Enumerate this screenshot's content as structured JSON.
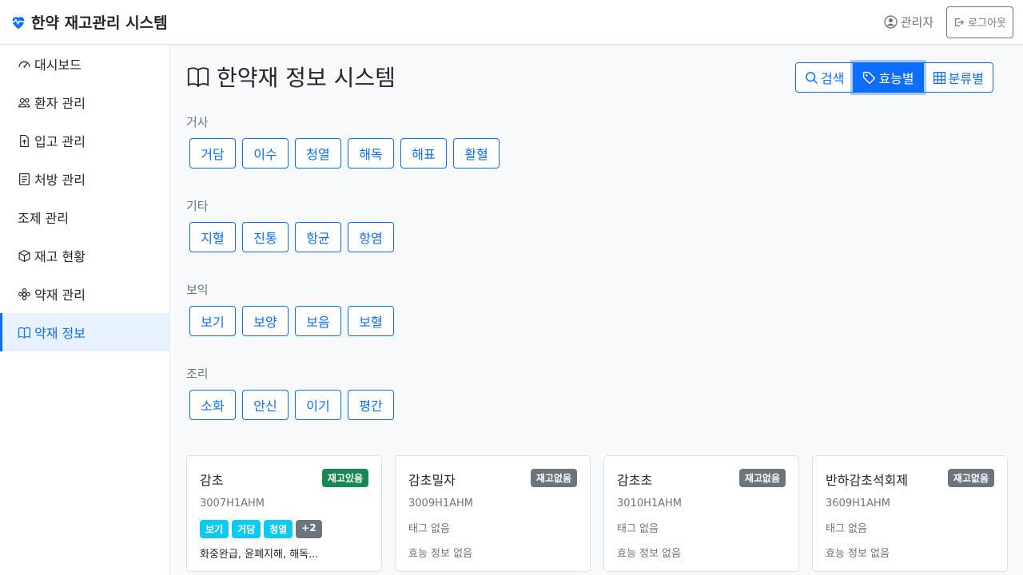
{
  "app": {
    "title": "한약 재고관리 시스템"
  },
  "header": {
    "user": "관리자",
    "logout": "로그아웃"
  },
  "sidebar": {
    "items": [
      {
        "label": "대시보드",
        "icon": "speedometer-icon"
      },
      {
        "label": "환자 관리",
        "icon": "people-icon"
      },
      {
        "label": "입고 관리",
        "icon": "file-arrow-up-icon"
      },
      {
        "label": "처방 관리",
        "icon": "prescription-icon"
      },
      {
        "label": "조제 관리",
        "icon": ""
      },
      {
        "label": "재고 현황",
        "icon": "box-icon"
      },
      {
        "label": "약재 관리",
        "icon": "flower-icon"
      },
      {
        "label": "약재 정보",
        "icon": "book-icon",
        "active": true
      }
    ]
  },
  "main": {
    "title": "한약재 정보 시스템",
    "view_buttons": [
      {
        "label": "검색",
        "icon": "search-icon"
      },
      {
        "label": "효능별",
        "icon": "tag-icon",
        "active": true
      },
      {
        "label": "분류별",
        "icon": "grid-icon"
      }
    ],
    "categories": [
      {
        "label": "거사",
        "tags": [
          "거담",
          "이수",
          "청열",
          "해독",
          "해표",
          "활혈"
        ]
      },
      {
        "label": "기타",
        "tags": [
          "지혈",
          "진통",
          "항균",
          "항염"
        ]
      },
      {
        "label": "보익",
        "tags": [
          "보기",
          "보양",
          "보음",
          "보혈"
        ]
      },
      {
        "label": "조리",
        "tags": [
          "소화",
          "안신",
          "이기",
          "평간"
        ]
      }
    ],
    "cards": [
      {
        "name": "감초",
        "status": "재고있음",
        "code": "3007H1AHM",
        "tags": [
          "보기",
          "거담",
          "청열"
        ],
        "more": "+2",
        "effect": "화중완급, 윤폐지해, 해독..."
      },
      {
        "name": "감초밀자",
        "status": "재고없음",
        "code": "3009H1AHM",
        "no_tags": "태그 없음",
        "no_effect": "효능 정보 없음"
      },
      {
        "name": "감초초",
        "status": "재고없음",
        "code": "3010H1AHM",
        "no_tags": "태그 없음",
        "no_effect": "효능 정보 없음"
      },
      {
        "name": "반하감초석회제",
        "status": "재고없음",
        "code": "3609H1AHM",
        "no_tags": "태그 없음",
        "no_effect": "효능 정보 없음"
      }
    ]
  },
  "colors": {
    "primary": "#0d6efd",
    "success": "#198754",
    "secondary": "#6c757d",
    "info": "#0dcaf0"
  }
}
